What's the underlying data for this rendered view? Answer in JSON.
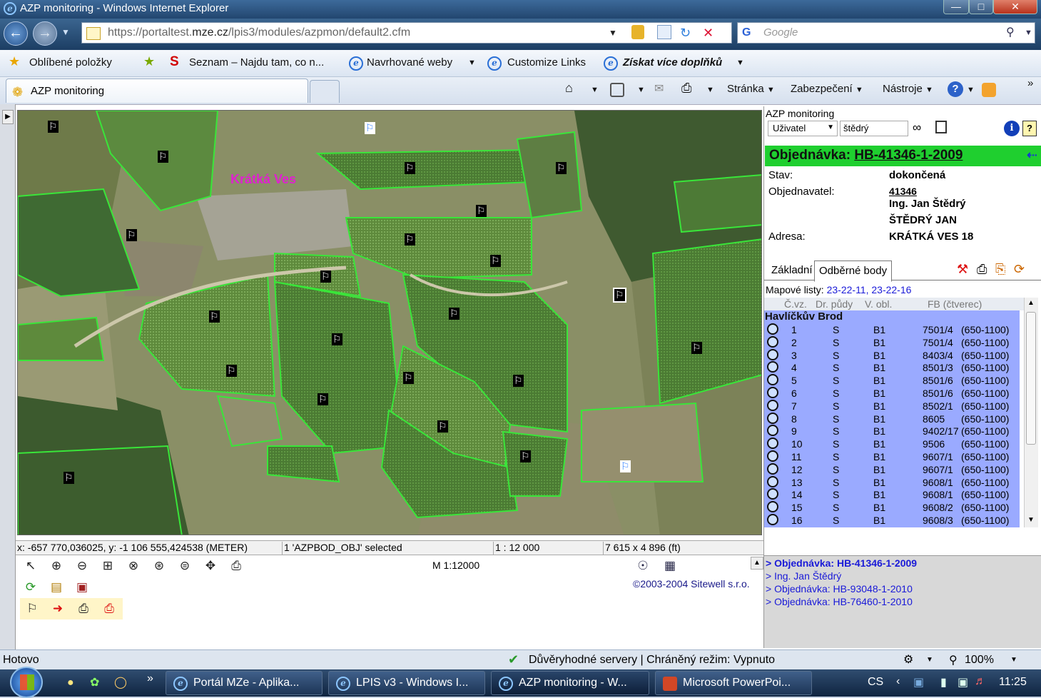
{
  "window": {
    "title": "AZP monitoring - Windows Internet Explorer"
  },
  "address": {
    "prefix": "https://portaltest.",
    "domain": "mze.cz",
    "suffix": "/lpis3/modules/azpmon/default2.cfm"
  },
  "search": {
    "placeholder": "Google"
  },
  "favorites": {
    "fav_label": "Oblíbené položky",
    "items": [
      "Seznam – Najdu tam, co n...",
      "Navrhované weby",
      "Customize Links",
      "Získat více doplňků"
    ]
  },
  "tabs": {
    "active": "AZP monitoring"
  },
  "commands": {
    "page": "Stránka",
    "security": "Zabezpečení",
    "tools": "Nástroje"
  },
  "map": {
    "village_label": "Krátká Ves"
  },
  "coordbar": {
    "coords": "x: -657 770,036025, y: -1 106 555,424538 (METER)",
    "selection": "1 'AZPBOD_OBJ' selected",
    "scale": "1 : 12 000",
    "extent": "7 615 x 4 896 (ft)"
  },
  "tools": {
    "scale_text": "M 1:12000",
    "copyright": "©2003-2004 Sitewell s.r.o."
  },
  "panel": {
    "header": "AZP monitoring",
    "user_select": "Uživatel",
    "user_input": "štědrý",
    "order_prefix": "Objednávka: ",
    "order_id": "HB-41346-1-2009",
    "stav_label": "Stav:",
    "stav_value": "dokončená",
    "objednavatel_label": "Objednavatel:",
    "objednavatel_id": "41346",
    "objednavatel_name1": "Ing. Jan Štědrý",
    "objednavatel_name2": "ŠTĚDRÝ JAN",
    "adresa_label": "Adresa:",
    "adresa_value": "KRÁTKÁ VES 18",
    "tab_basic": "Základní",
    "tab_points": "Odběrné body",
    "maps_label": "Mapové listy:",
    "maps_value": "23-22-11, 23-22-16",
    "col_headers": {
      "cvz": "Č.vz.",
      "soil": "Dr. půdy",
      "area": "V. obl.",
      "fb": "FB (čtverec)"
    },
    "group": "Havlíčkův Brod",
    "rows": [
      {
        "n": "1",
        "s": "S",
        "b": "B1",
        "fb": "7501/4",
        "r": "(650-1100)"
      },
      {
        "n": "2",
        "s": "S",
        "b": "B1",
        "fb": "7501/4",
        "r": "(650-1100)"
      },
      {
        "n": "3",
        "s": "S",
        "b": "B1",
        "fb": "8403/4",
        "r": "(650-1100)"
      },
      {
        "n": "4",
        "s": "S",
        "b": "B1",
        "fb": "8501/3",
        "r": "(650-1100)"
      },
      {
        "n": "5",
        "s": "S",
        "b": "B1",
        "fb": "8501/6",
        "r": "(650-1100)"
      },
      {
        "n": "6",
        "s": "S",
        "b": "B1",
        "fb": "8501/6",
        "r": "(650-1100)"
      },
      {
        "n": "7",
        "s": "S",
        "b": "B1",
        "fb": "8502/1",
        "r": "(650-1100)"
      },
      {
        "n": "8",
        "s": "S",
        "b": "B1",
        "fb": "8605",
        "r": "(650-1100)"
      },
      {
        "n": "9",
        "s": "S",
        "b": "B1",
        "fb": "9402/17",
        "r": "(650-1100)"
      },
      {
        "n": "10",
        "s": "S",
        "b": "B1",
        "fb": "9506",
        "r": "(650-1100)"
      },
      {
        "n": "11",
        "s": "S",
        "b": "B1",
        "fb": "9607/1",
        "r": "(650-1100)"
      },
      {
        "n": "12",
        "s": "S",
        "b": "B1",
        "fb": "9607/1",
        "r": "(650-1100)"
      },
      {
        "n": "13",
        "s": "S",
        "b": "B1",
        "fb": "9608/1",
        "r": "(650-1100)"
      },
      {
        "n": "14",
        "s": "S",
        "b": "B1",
        "fb": "9608/1",
        "r": "(650-1100)"
      },
      {
        "n": "15",
        "s": "S",
        "b": "B1",
        "fb": "9608/2",
        "r": "(650-1100)"
      },
      {
        "n": "16",
        "s": "S",
        "b": "B1",
        "fb": "9608/3",
        "r": "(650-1100)"
      }
    ]
  },
  "links": [
    "> Objednávka: HB-41346-1-2009",
    "> Ing. Jan Štědrý",
    "> Objednávka: HB-93048-1-2010",
    "> Objednávka: HB-76460-1-2010"
  ],
  "status": {
    "left": "Hotovo",
    "mode": "Důvěryhodné servery | Chráněný režim: Vypnuto",
    "zoom": "100%"
  },
  "taskbar": {
    "items": [
      "Portál MZe - Aplika...",
      "LPIS v3 - Windows I...",
      "AZP monitoring - W...",
      "Microsoft PowerPoi..."
    ],
    "lang": "CS",
    "time": "11:25"
  },
  "colors": {
    "order_bar": "#1fcf2f",
    "list_bg": "#9aaaff",
    "field_outline": "#39e639",
    "village_label": "#e020d0"
  }
}
